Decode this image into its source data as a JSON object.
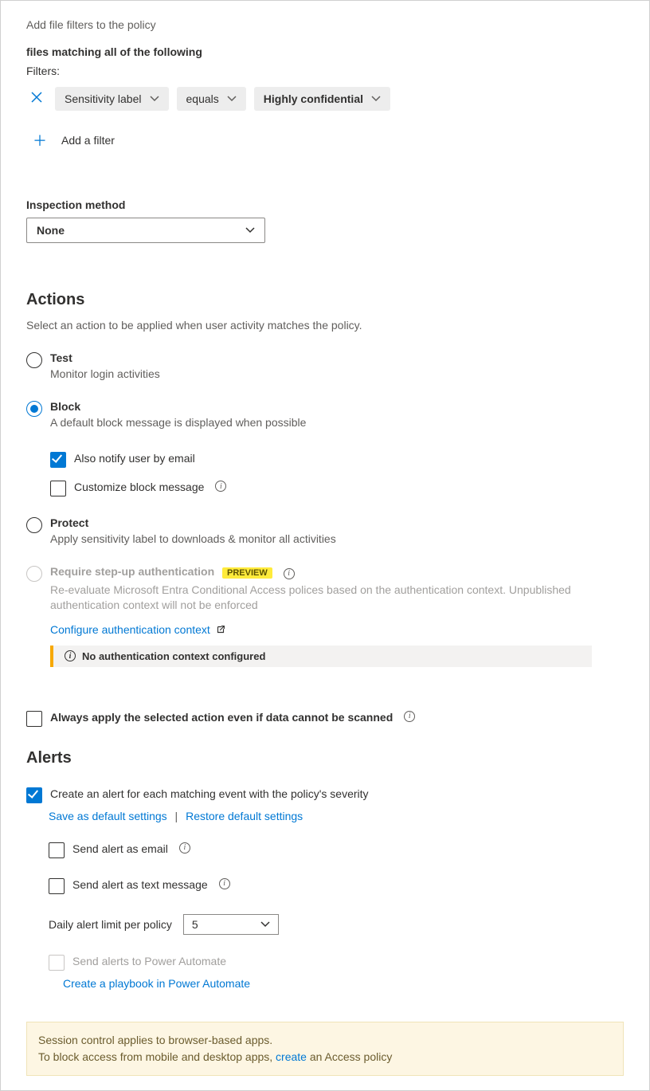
{
  "filters": {
    "title": "Add file filters to the policy",
    "matching_line": "files matching all of the following",
    "label": "Filters:",
    "chip_field": "Sensitivity label",
    "chip_operator": "equals",
    "chip_value": "Highly confidential",
    "add_filter": "Add a filter"
  },
  "inspection": {
    "label": "Inspection method",
    "value": "None"
  },
  "actions": {
    "heading": "Actions",
    "description": "Select an action to be applied when user activity matches the policy.",
    "test": {
      "title": "Test",
      "desc": "Monitor login activities"
    },
    "block": {
      "title": "Block",
      "desc": "A default block message is displayed when possible",
      "notify_email": "Also notify user by email",
      "customize": "Customize block message"
    },
    "protect": {
      "title": "Protect",
      "desc": "Apply sensitivity label to downloads & monitor all activities"
    },
    "stepup": {
      "title": "Require step-up authentication",
      "badge": "PREVIEW",
      "desc": "Re-evaluate Microsoft Entra Conditional Access polices based on the authentication context. Unpublished authentication context will not be enforced",
      "config_link": "Configure authentication context",
      "warn": "No authentication context configured"
    },
    "always_apply": "Always apply the selected action even if data cannot be scanned"
  },
  "alerts": {
    "heading": "Alerts",
    "create_alert": "Create an alert for each matching event with the policy's severity",
    "save_default": "Save as default settings",
    "restore_default": "Restore default settings",
    "send_email": "Send alert as email",
    "send_text": "Send alert as text message",
    "daily_limit_label": "Daily alert limit per policy",
    "daily_limit_value": "5",
    "send_power_automate": "Send alerts to Power Automate",
    "create_playbook": "Create a playbook in Power Automate"
  },
  "footer": {
    "line1": "Session control applies to browser-based apps.",
    "line2_pre": "To block access from mobile and desktop apps, ",
    "line2_link": "create",
    "line2_post": " an Access policy"
  }
}
